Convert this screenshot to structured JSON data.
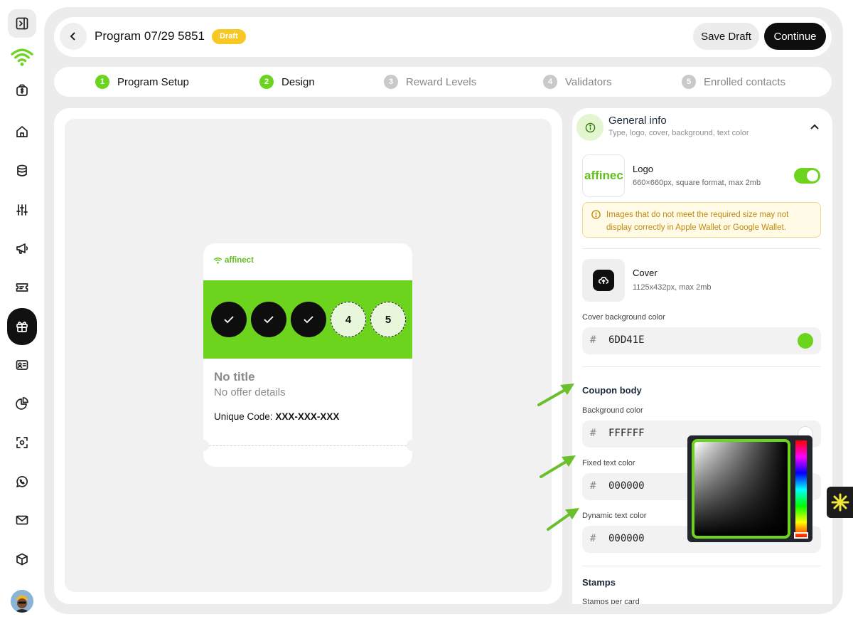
{
  "header": {
    "title": "Program 07/29 5851",
    "status_badge": "Draft",
    "save_draft_label": "Save Draft",
    "continue_label": "Continue"
  },
  "steps": [
    {
      "number": "1",
      "label": "Program Setup",
      "state": "done"
    },
    {
      "number": "2",
      "label": "Design",
      "state": "done"
    },
    {
      "number": "3",
      "label": "Reward Levels",
      "state": "todo"
    },
    {
      "number": "4",
      "label": "Validators",
      "state": "todo"
    },
    {
      "number": "5",
      "label": "Enrolled contacts",
      "state": "todo"
    }
  ],
  "sidebar": {
    "icons": [
      "collapse-sidebar-icon",
      "brand-logo-icon",
      "wallet-dollar-icon",
      "home-icon",
      "database-icon",
      "sliders-icon",
      "megaphone-icon",
      "ticket-icon",
      "gift-icon",
      "contact-card-icon",
      "pie-chart-icon",
      "scan-icon",
      "whatsapp-icon",
      "mail-icon",
      "package-icon",
      "user-avatar"
    ],
    "active": "gift-icon"
  },
  "preview": {
    "brand_name": "affinect",
    "stamps": [
      {
        "type": "filled",
        "label": ""
      },
      {
        "type": "filled",
        "label": ""
      },
      {
        "type": "filled",
        "label": ""
      },
      {
        "type": "empty",
        "label": "4"
      },
      {
        "type": "empty",
        "label": "5"
      }
    ],
    "title": "No title",
    "offer": "No offer details",
    "code_label": "Unique Code:",
    "code_value": "XXX-XXX-XXX"
  },
  "settings": {
    "general_info": {
      "title": "General info",
      "subtitle": "Type, logo, cover, background, text color"
    },
    "logo": {
      "thumb_text": "affinec",
      "title": "Logo",
      "spec": "660×660px, square format, max 2mb",
      "enabled": true
    },
    "warning": "Images that do not meet the required size may not display correctly in Apple Wallet or Google Wallet.",
    "cover": {
      "title": "Cover",
      "spec": "1125x432px, max 2mb"
    },
    "cover_bg": {
      "label": "Cover background color",
      "hash": "#",
      "value": "6DD41E",
      "swatch": "#6DD41E"
    },
    "coupon_body": {
      "title": "Coupon body",
      "background": {
        "label": "Background color",
        "hash": "#",
        "value": "FFFFFF",
        "swatch": "#FFFFFF"
      },
      "fixed_text": {
        "label": "Fixed text color",
        "hash": "#",
        "value": "000000",
        "swatch": "#000000"
      },
      "dynamic_text": {
        "label": "Dynamic text color",
        "hash": "#",
        "value": "000000",
        "swatch": "#000000"
      }
    },
    "stamps": {
      "title": "Stamps",
      "per_card_label": "Stamps per card"
    }
  },
  "colors": {
    "accent_green": "#6DD41E",
    "draft_yellow": "#F7C823",
    "dark": "#0E0E0E"
  }
}
